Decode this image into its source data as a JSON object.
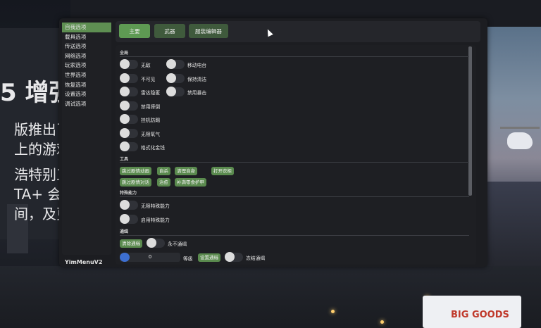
{
  "background": {
    "ad_title": "5 增强",
    "ad_lines": [
      "版推出了此",
      "上的游戏",
      "浩特别工",
      "TA+ 会员",
      "间，及更多"
    ],
    "truck_text": "BIG GOODS"
  },
  "sidebar": {
    "items": [
      {
        "label": "自我选项",
        "active": true
      },
      {
        "label": "载具选项",
        "active": false
      },
      {
        "label": "传送选项",
        "active": false
      },
      {
        "label": "网络选项",
        "active": false
      },
      {
        "label": "玩家选项",
        "active": false
      },
      {
        "label": "世界选项",
        "active": false
      },
      {
        "label": "恢复选项",
        "active": false
      },
      {
        "label": "设置选项",
        "active": false
      },
      {
        "label": "调试选项",
        "active": false
      }
    ],
    "footer_title": "YimMenuV2"
  },
  "tabs": [
    {
      "label": "主要",
      "active": true
    },
    {
      "label": "武器",
      "active": false
    },
    {
      "label": "服装编辑器",
      "active": false
    }
  ],
  "sections": {
    "general": {
      "title": "全局",
      "left_toggles": [
        "无敌",
        "不可见",
        "雷达隐匿",
        "禁用摔倒",
        "挂机防踢",
        "无限氧气",
        "格式化金钱"
      ],
      "right_toggles": [
        "移动电台",
        "保持清洁",
        "禁用暴击"
      ]
    },
    "tools": {
      "title": "工具",
      "row1": [
        "跳过剧情动画",
        "自杀",
        "清理自身",
        "打开衣柜"
      ],
      "row2": [
        "跳过剧情对话",
        "治愈",
        "补满零食护甲"
      ]
    },
    "special": {
      "title": "特殊能力",
      "toggles": [
        "无限特殊能力",
        "启用特殊能力"
      ]
    },
    "wanted": {
      "title": "通缉",
      "clear_button": "清除通缉",
      "never_wanted": "永不通缉",
      "level_value": "0",
      "level_label": "等级",
      "set_button": "设置通缉",
      "freeze_label": "冻结通缉"
    }
  }
}
